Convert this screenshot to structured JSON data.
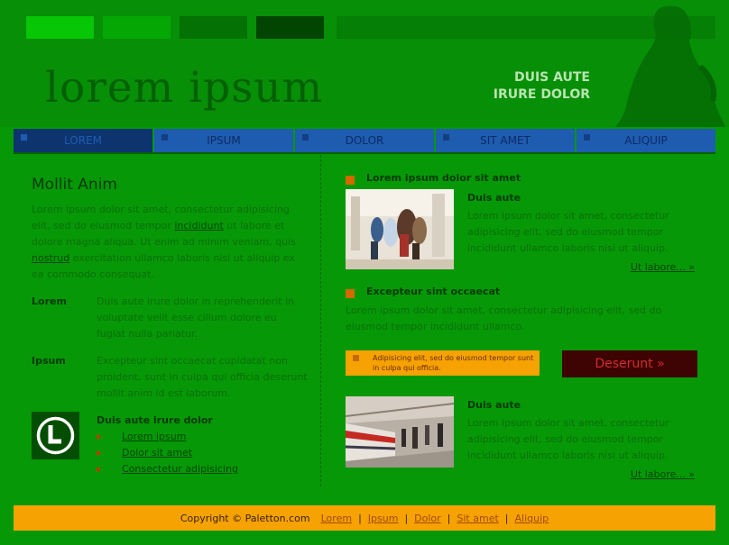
{
  "header": {
    "logo_text": "lorem ipsum",
    "tagline_line1": "DUIS AUTE",
    "tagline_line2": "IRURE DOLOR",
    "swatch_colors": [
      "#06C606",
      "#04A704",
      "#037103",
      "#024402",
      "#067F06"
    ]
  },
  "nav": {
    "items": [
      {
        "label": "LOREM",
        "active": true
      },
      {
        "label": "IPSUM",
        "active": false
      },
      {
        "label": "DOLOR",
        "active": false
      },
      {
        "label": "SIT AMET",
        "active": false
      },
      {
        "label": "ALIQUIP",
        "active": false
      }
    ]
  },
  "left": {
    "title": "Mollit Anim",
    "intro_1": "Lorem ipsum dolor sit amet, consectetur adipisicing elit, sed do eiusmod tempor ",
    "intro_link_1": "incididunt",
    "intro_2": " ut labore et dolore magna aliqua. Ut enim ad minim veniam, quis ",
    "intro_link_2": "nostrud",
    "intro_3": " exercitation ullamco laboris nisi ut aliquip ex ea commodo consequat.",
    "definitions": [
      {
        "term": "Lorem",
        "text": "Duis aute irure dolor in reprehenderit in voluptate velit esse cillum dolore eu fugiat nulla pariatur."
      },
      {
        "term": "Ipsum",
        "text": "Excepteur sint occaecat cupidatat non proident, sunt in culpa qui officia deserunt mollit anim id est laborum."
      }
    ],
    "list_title": "Duis aute irure dolor",
    "list_items": [
      "Lorem ipsum",
      "Dolor sit amet",
      "Consectetur adipisicing"
    ]
  },
  "right": {
    "section1": {
      "heading": "Lorem ipsum dolor sit amet",
      "subheading": "Duis aute",
      "text": "Lorem ipsum dolor sit amet, consectetur adipisicing elit, sed do eiusmod tempor incididunt ullamco laboris nisi ut aliquip.",
      "more": "Ut labore... »"
    },
    "section2": {
      "heading": "Excepteur sint occaecat",
      "text": "Lorem ipsum dolor sit amet, consectetur adipisicing elit, sed do eiusmod tempor incididunt ullamco."
    },
    "notice": "Adipisicing elit, sed do eiusmod tempor sunt in culpa qui officia.",
    "cta_button": "Deserunt »",
    "section3": {
      "subheading": "Duis aute",
      "text": "Lorem ipsum dolor sit amet, consectetur adipisicing elit, sed do eiusmod tempor incididunt ullamco laboris nisi ut aliquip.",
      "more": "Ut labore... »"
    }
  },
  "footer": {
    "copyright": "Copyright © Paletton.com",
    "links": [
      "Lorem",
      "Ipsum",
      "Dolor",
      "Sit amet",
      "Aliquip"
    ],
    "separator": "|"
  },
  "colors": {
    "background": "#069806",
    "nav_blue": "#1E5CB0",
    "footer_orange": "#F5A202",
    "cta_dark_red": "#3E0303"
  }
}
